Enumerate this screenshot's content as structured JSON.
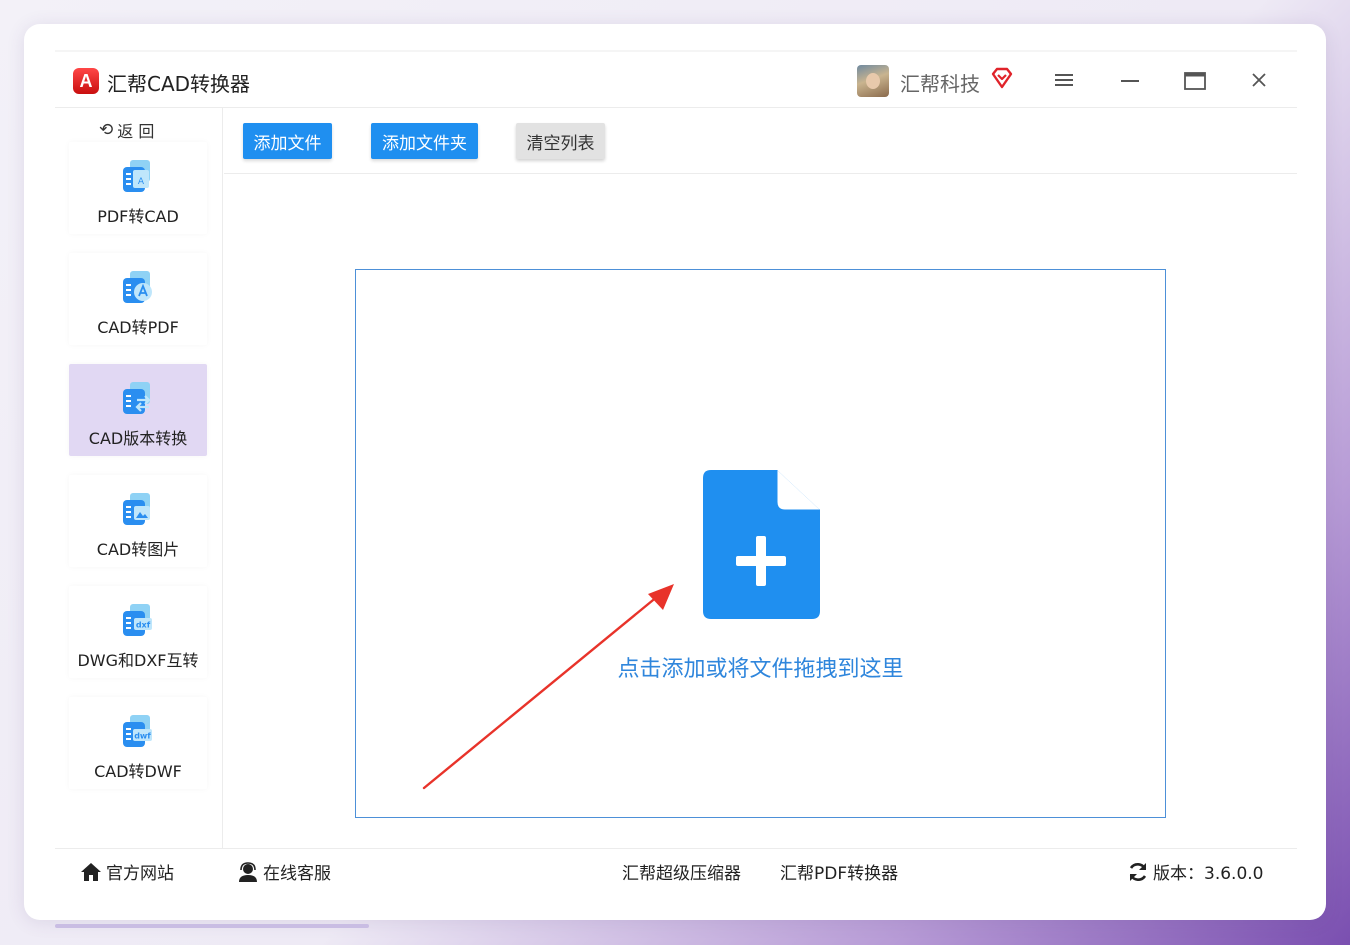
{
  "app": {
    "title": "汇帮CAD转换器",
    "logo_letter": "A"
  },
  "user": {
    "name": "汇帮科技"
  },
  "sidebar": {
    "back_label": "返 回",
    "items": [
      {
        "label": "PDF转CAD",
        "icon": "pdf-to-cad-icon"
      },
      {
        "label": "CAD转PDF",
        "icon": "cad-to-pdf-icon"
      },
      {
        "label": "CAD版本转换",
        "icon": "cad-version-icon",
        "active": true
      },
      {
        "label": "CAD转图片",
        "icon": "cad-to-image-icon"
      },
      {
        "label": "DWG和DXF互转",
        "icon": "dwg-dxf-icon"
      },
      {
        "label": "CAD转DWF",
        "icon": "cad-to-dwf-icon"
      }
    ]
  },
  "toolbar": {
    "add_file": "添加文件",
    "add_folder": "添加文件夹",
    "clear_list": "清空列表"
  },
  "dropzone": {
    "hint": "点击添加或将文件拖拽到这里"
  },
  "footer": {
    "website": "官方网站",
    "support": "在线客服",
    "compressor": "汇帮超级压缩器",
    "pdf_converter": "汇帮PDF转换器",
    "version": "版本：3.6.0.0"
  },
  "colors": {
    "primary": "#1f8ff0",
    "active_nav": "#e1d8f3",
    "vip": "#e0232a",
    "arrow": "#e8332a"
  }
}
